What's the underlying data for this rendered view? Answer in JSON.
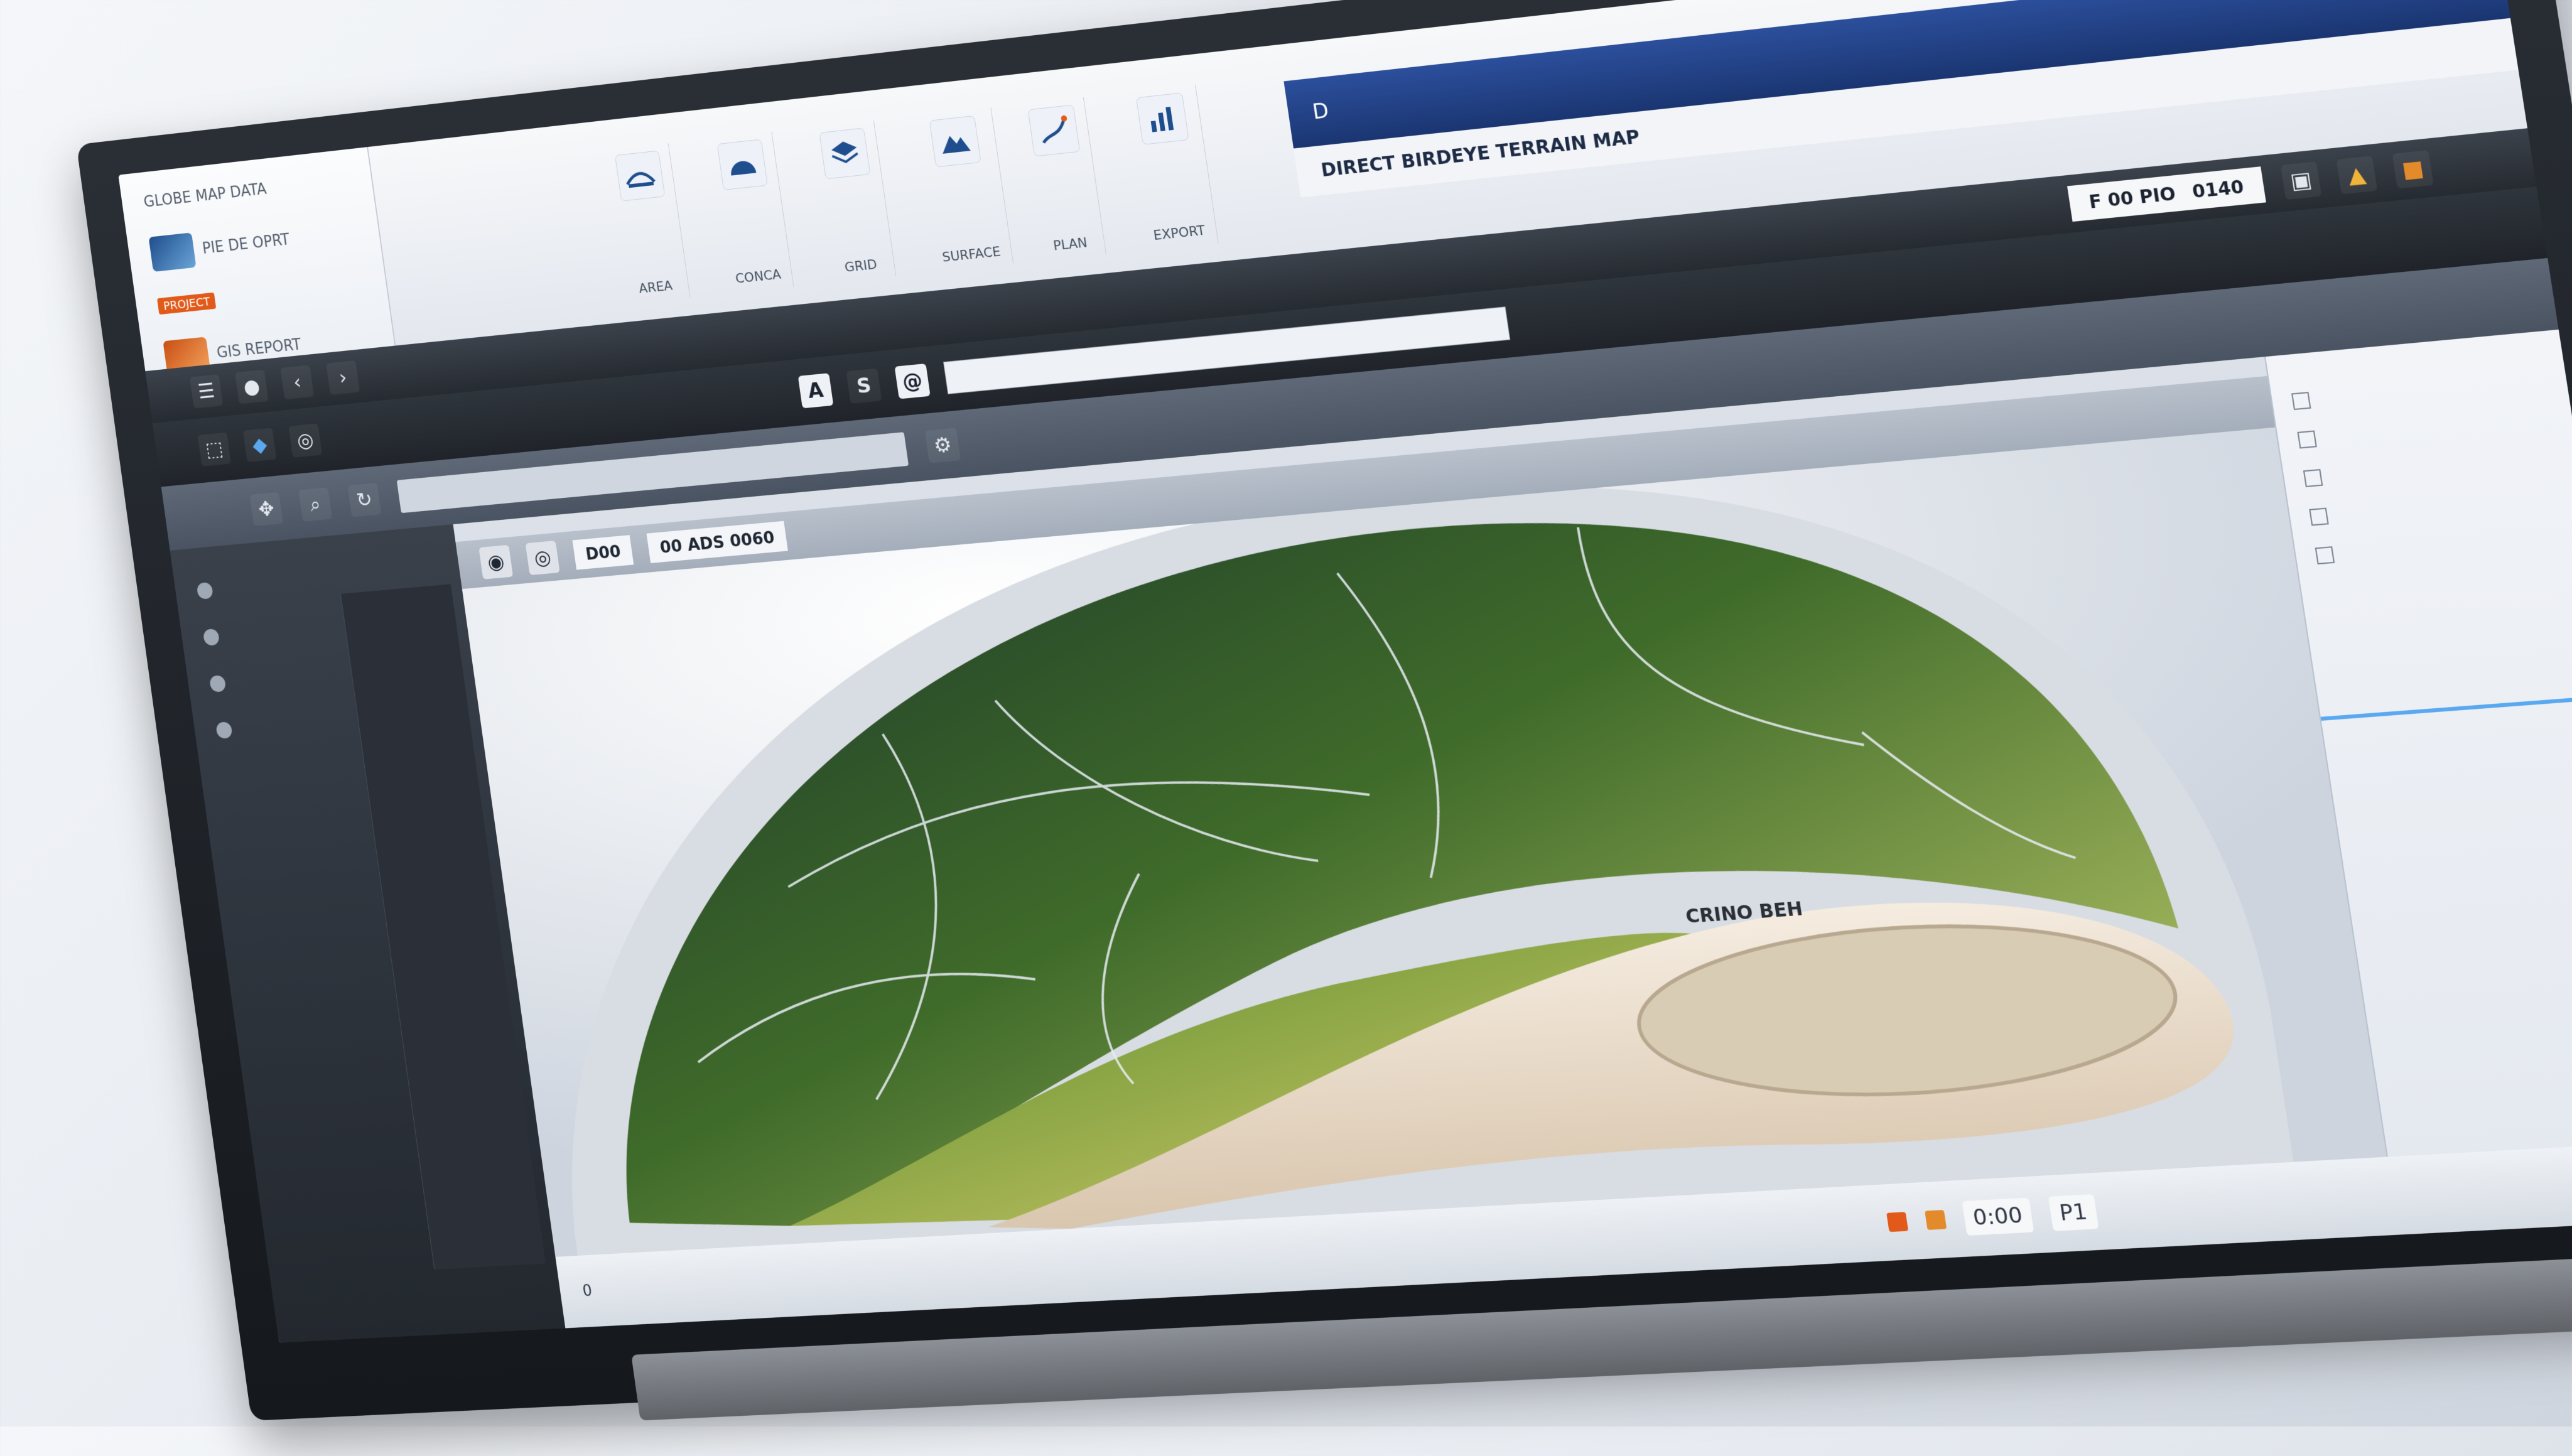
{
  "ribbon": {
    "left_panel_rows": [
      "GLOBE MAP DATA",
      "PIE DE OPRT",
      "PROJECT",
      "GIS REPORT"
    ],
    "groups": [
      {
        "label": "AREA",
        "icon": "bridge-icon"
      },
      {
        "label": "CONCA",
        "icon": "dome-icon"
      },
      {
        "label": "GRID",
        "icon": "layers-icon"
      },
      {
        "label": "SURFACE",
        "icon": "terrain-icon"
      },
      {
        "label": "PLAN",
        "icon": "route-icon"
      },
      {
        "label": "EXPORT",
        "icon": "chart-icon"
      }
    ],
    "window_title": "D",
    "window_subtitle": "DIRECT BIRDEYE TERRAIN MAP"
  },
  "toolbar": {
    "buttons": [
      "A",
      "S",
      "@"
    ],
    "status_label": "F 00 PIO",
    "status_value": "0140"
  },
  "viewport": {
    "header_label": "D00",
    "header_value": "00 ADS 0060",
    "stadium_label": "CRINO BEH"
  },
  "bottom": {
    "counter": "0",
    "timecode": "0:00",
    "page": "P1"
  },
  "colors": {
    "terrain": "#4f7a2e",
    "terrain_light": "#b8c66b",
    "track": "#eadcc9",
    "ribbon_blue": "#2c4f9c"
  }
}
